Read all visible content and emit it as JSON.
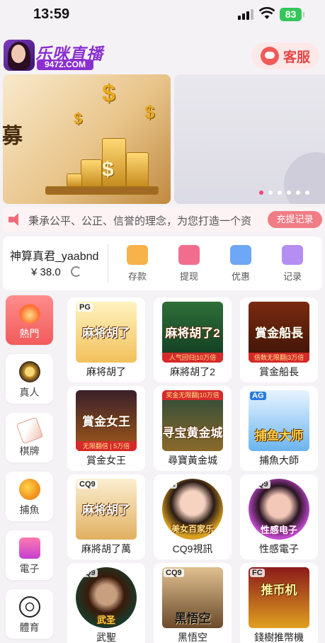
{
  "status": {
    "time": "13:59",
    "battery": "83"
  },
  "header": {
    "logo_text": "乐咪直播",
    "logo_url": "9472.COM",
    "service_label": "客服"
  },
  "banner": {
    "char": "募",
    "slides": 6,
    "active": 0
  },
  "marquee": {
    "text": "秉承公平、公正、信誉的理念，为您打造一个资",
    "recharge_label": "充提记录"
  },
  "wallet": {
    "username": "神算真君_yaabnd",
    "balance": "¥ 38.0",
    "actions": [
      {
        "label": "存款",
        "icon": "wallet-icon",
        "color": "#f7b24a"
      },
      {
        "label": "提现",
        "icon": "withdraw-icon",
        "color": "#f26d8d"
      },
      {
        "label": "优惠",
        "icon": "gift-icon",
        "color": "#6ea7f5"
      },
      {
        "label": "记录",
        "icon": "record-icon",
        "color": "#b58ef2"
      }
    ]
  },
  "categories": [
    {
      "label": "熱門",
      "icon": "fire-icon",
      "active": true
    },
    {
      "label": "真人",
      "icon": "chip-icon",
      "active": false
    },
    {
      "label": "棋牌",
      "icon": "cards-icon",
      "active": false
    },
    {
      "label": "捕魚",
      "icon": "fish-icon",
      "active": false
    },
    {
      "label": "電子",
      "icon": "slot-icon",
      "active": false
    },
    {
      "label": "體育",
      "icon": "soccer-ball-icon",
      "active": false
    }
  ],
  "games": [
    {
      "name": "麻将胡了",
      "thumb_text": "麻将胡了",
      "badge": "PG",
      "strip": ""
    },
    {
      "name": "麻將胡了2",
      "thumb_text": "麻将胡了2",
      "badge": "",
      "strip": "人气回归|10万倍"
    },
    {
      "name": "賞金船長",
      "thumb_text": "賞金船長",
      "badge": "",
      "strip": "倍数无限翻|3万倍"
    },
    {
      "name": "賞金女王",
      "thumb_text": "賞金女王",
      "badge": "",
      "strip": "无限翻倍 | 5万倍"
    },
    {
      "name": "尋寶黃金城",
      "thumb_text": "寻宝黄金城",
      "badge": "",
      "strip_top": "奖金无限翻|10万倍"
    },
    {
      "name": "捕魚大師",
      "thumb_text": "捕鱼大师",
      "badge": "AG",
      "strip": ""
    },
    {
      "name": "麻將胡了萬",
      "thumb_text": "麻将胡了",
      "badge": "CQ9",
      "strip": ""
    },
    {
      "name": "CQ9視訊",
      "thumb_text": "美女百家乐",
      "badge": "mt",
      "strip": ""
    },
    {
      "name": "性感電子",
      "thumb_text": "性感电子",
      "badge": "CQ9",
      "strip": ""
    },
    {
      "name": "武聖",
      "thumb_text": "武圣",
      "badge": "CQ9",
      "strip": ""
    },
    {
      "name": "黑悟空",
      "thumb_text": "黑悟空",
      "badge": "CQ9",
      "strip": ""
    },
    {
      "name": "錢樹推幣機",
      "thumb_text": "推币机",
      "badge": "FC",
      "strip": ""
    }
  ],
  "colors": {
    "accent": "#f25b5b",
    "brand": "#8b2fd0",
    "active_dot": "#f0477a"
  }
}
